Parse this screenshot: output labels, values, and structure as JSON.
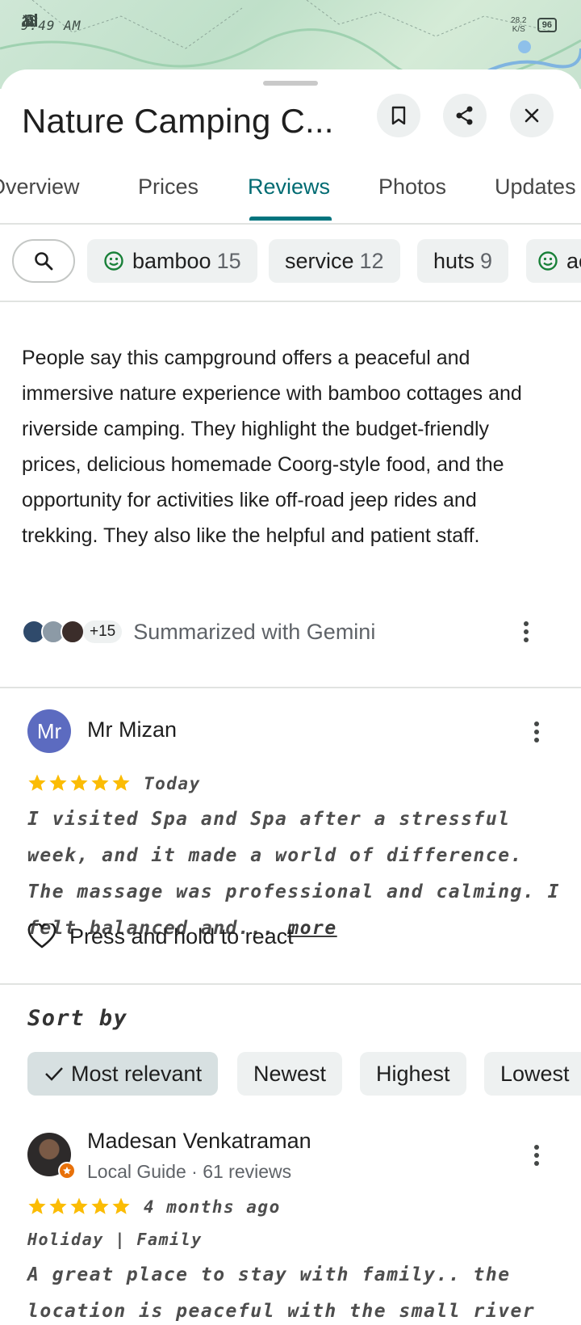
{
  "status_bar": {
    "time": "9:49 AM",
    "net_speed": "28.2 K/S",
    "battery": "96"
  },
  "place": {
    "title": "Nature Camping C..."
  },
  "tabs": [
    {
      "label": "Overview"
    },
    {
      "label": "Prices"
    },
    {
      "label": "Reviews"
    },
    {
      "label": "Photos"
    },
    {
      "label": "Updates"
    }
  ],
  "active_tab": "Reviews",
  "topic_chips": [
    {
      "label": "bamboo",
      "count": "15",
      "icon": "smile-icon"
    },
    {
      "label": "service",
      "count": "12"
    },
    {
      "label": "huts",
      "count": "9"
    },
    {
      "label": "ac",
      "count": "",
      "icon": "smile-icon"
    }
  ],
  "summary": {
    "text": "People say this campground offers a peaceful and immersive nature experience with bamboo cottages and riverside camping. They highlight the budget-friendly prices, delicious homemade Coorg-style food, and the opportunity for activities like off-road jeep rides and trekking. They also like the helpful and patient staff.",
    "contributors_badge": "+15",
    "attribution": "Summarized with Gemini"
  },
  "review_1": {
    "avatar_initials": "Mr",
    "name": "Mr Mizan",
    "rating": 5,
    "date": "Today",
    "text": "I visited Spa and Spa after a stressful week, and it made a world of difference. The massage was professional and calming. I felt balanced and...",
    "more_label": "more",
    "react_label": "Press and hold to react"
  },
  "sort": {
    "title": "Sort by",
    "options": [
      "Most relevant",
      "Newest",
      "Highest",
      "Lowest"
    ],
    "selected": "Most relevant"
  },
  "review_2": {
    "name": "Madesan Venkatraman",
    "meta": "Local Guide · 61 reviews",
    "rating": 5,
    "date": "4 months ago",
    "tags": "Holiday | Family",
    "text": "A great place to stay with family.. the location is peaceful with the small river water passing and"
  },
  "colors": {
    "accent_teal": "#00747e",
    "star_yellow": "#fbbc04",
    "avatar_purple": "#5c6bc0",
    "smile_green": "#188038",
    "guide_orange": "#e8710a"
  }
}
